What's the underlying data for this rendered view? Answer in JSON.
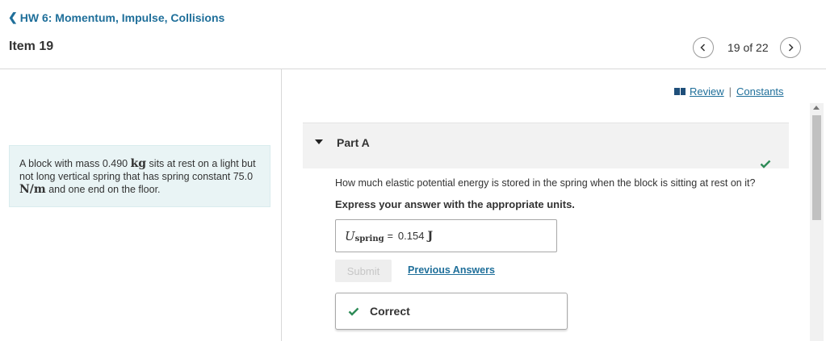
{
  "header": {
    "back_label": "HW 6: Momentum, Impulse, Collisions",
    "item_title": "Item 19",
    "pager": {
      "text": "19 of 22"
    }
  },
  "resources": {
    "review_label": "Review",
    "separator": "|",
    "constants_label": "Constants"
  },
  "problem": {
    "text_1": "A block with mass 0.490 ",
    "unit_kg": "kg",
    "text_2": " sits at rest on a light but not long vertical spring that has spring constant 75.0 ",
    "unit_nm": "N/m",
    "text_3": " and one end on the floor."
  },
  "part": {
    "title": "Part A",
    "status": "correct",
    "question": "How much elastic potential energy is stored in the spring when the block is sitting at rest on it?",
    "instruction": "Express your answer with the appropriate units.",
    "answer": {
      "variable": "U",
      "subscript": "spring",
      "equals": "=",
      "value": "0.154",
      "unit": "J"
    },
    "submit_label": "Submit",
    "previous_answers_label": "Previous Answers",
    "feedback_label": "Correct"
  },
  "colors": {
    "link": "#1f6f9a",
    "check": "#2e8b57",
    "problem_bg": "#e9f4f5"
  },
  "icons": [
    "chevron-left-icon",
    "chevron-right-icon",
    "book-icon",
    "caret-down-icon",
    "checkmark-icon"
  ]
}
